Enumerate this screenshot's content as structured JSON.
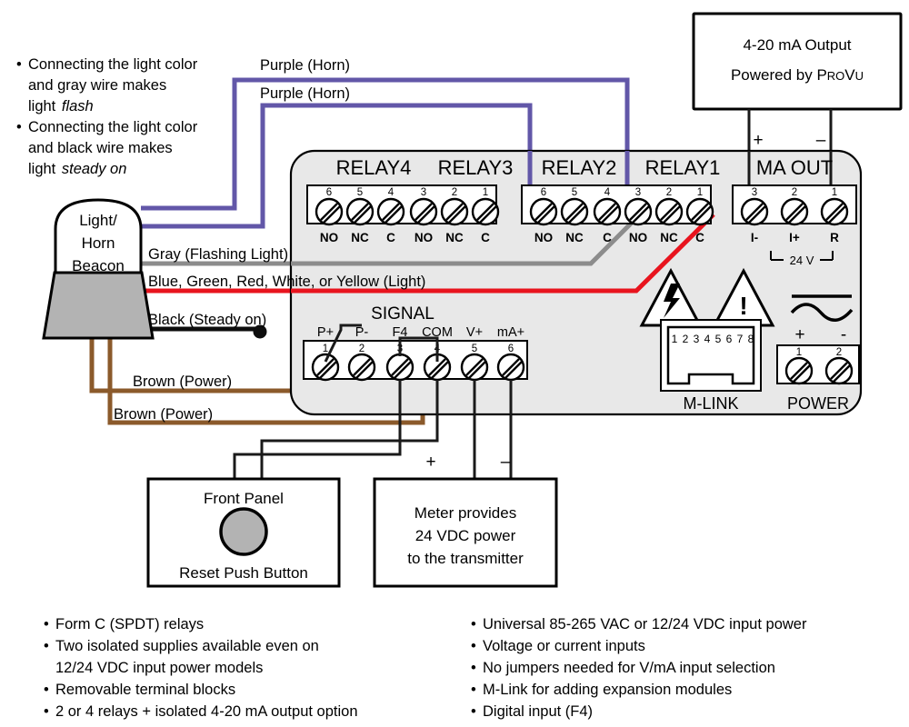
{
  "notes": {
    "flash": [
      "Connecting the light color",
      "and gray wire makes",
      "light "
    ],
    "flash_em": "flash",
    "steady": [
      "Connecting the light color",
      "and black wire makes",
      "light "
    ],
    "steady_em": "steady on"
  },
  "beacon": {
    "lines": [
      "Light/",
      "Horn",
      "Beacon"
    ]
  },
  "wire_labels": {
    "purple_top": "Purple (Horn)",
    "purple_second": "Purple (Horn)",
    "gray": "Gray (Flashing Light)",
    "light": "Blue, Green, Red, White, or Yellow (Light)",
    "black": "Black (Steady on)",
    "brown_top": "Brown (Power)",
    "brown_bottom": "Brown (Power)"
  },
  "relays": [
    {
      "name": "RELAY4",
      "terminals": [
        {
          "num": "6",
          "fn": "NO"
        },
        {
          "num": "5",
          "fn": "NC"
        },
        {
          "num": "4",
          "fn": "C"
        },
        {
          "num": "3",
          "fn": "NO"
        },
        {
          "num": "2",
          "fn": "NC"
        },
        {
          "num": "1",
          "fn": "C"
        }
      ]
    },
    {
      "name": "RELAY3"
    },
    {
      "name": "RELAY2",
      "terminals": [
        {
          "num": "6",
          "fn": "NO"
        },
        {
          "num": "5",
          "fn": "NC"
        },
        {
          "num": "4",
          "fn": "C"
        },
        {
          "num": "3",
          "fn": "NO"
        },
        {
          "num": "2",
          "fn": "NC"
        },
        {
          "num": "1",
          "fn": "C"
        }
      ]
    },
    {
      "name": "RELAY1"
    }
  ],
  "ma_out": {
    "title": "MA OUT",
    "terminals": [
      {
        "num": "3",
        "fn": "I-"
      },
      {
        "num": "2",
        "fn": "I+"
      },
      {
        "num": "1",
        "fn": "R"
      }
    ],
    "bracket_label": "24 V",
    "plus": "+",
    "minus": "–"
  },
  "signal": {
    "title": "SIGNAL",
    "terminals": [
      {
        "num": "1",
        "fn": "P+"
      },
      {
        "num": "2",
        "fn": "P-"
      },
      {
        "num": "3",
        "fn": "F4"
      },
      {
        "num": "4",
        "fn": "COM"
      },
      {
        "num": "5",
        "fn": "V+"
      },
      {
        "num": "6",
        "fn": "mA+"
      }
    ]
  },
  "mlink": {
    "title": "M-LINK",
    "pins": [
      "1",
      "2",
      "3",
      "4",
      "5",
      "6",
      "7",
      "8"
    ]
  },
  "power": {
    "title": "POWER",
    "terminals": [
      {
        "num": "1"
      },
      {
        "num": "2"
      }
    ],
    "plus": "+",
    "minus": "-"
  },
  "boxes": {
    "output": {
      "line1": "4-20 mA Output",
      "line2_pre": "Powered by ",
      "line2_p": "P",
      "line2_ro": "RO",
      "line2_v": "V",
      "line2_u": "U"
    },
    "front_panel": {
      "title": "Front Panel",
      "caption": "Reset Push Button"
    },
    "meter_power": {
      "lines": [
        "Meter provides",
        "24 VDC power",
        "to the transmitter"
      ],
      "plus": "+",
      "minus": "–"
    }
  },
  "features_left": [
    "Form C (SPDT) relays",
    "Two isolated supplies available even on",
    "12/24 VDC input power models",
    "Removable terminal blocks",
    "2 or 4 relays + isolated 4-20 mA output option"
  ],
  "features_right": [
    "Universal 85-265 VAC or 12/24 VDC input power",
    "Voltage or current inputs",
    "No jumpers needed for V/mA input selection",
    "M-Link for adding expansion modules",
    "Digital input (F4)"
  ],
  "colors": {
    "purple": "#6257a8",
    "gray_wire": "#8c8c8c",
    "red_wire": "#e8141e",
    "brown_wire": "#8b5a2b",
    "black_wire": "#0d0d0d",
    "enclosure": "#e8e8e8"
  }
}
